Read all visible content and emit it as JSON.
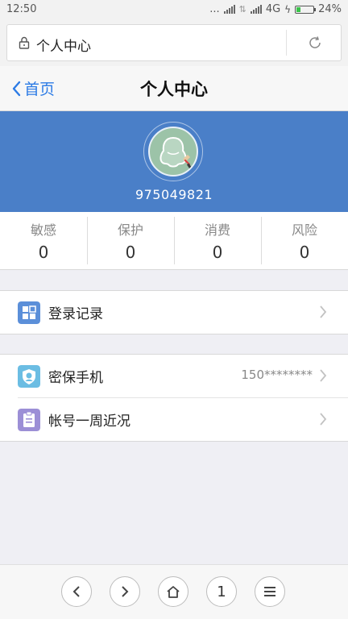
{
  "status_bar": {
    "time": "12:50",
    "dots": "...",
    "network": "4G",
    "battery": "24%",
    "battery_level": 0.24
  },
  "address_bar": {
    "title": "个人中心"
  },
  "nav": {
    "back_label": "首页",
    "title": "个人中心"
  },
  "profile": {
    "user_id": "975049821",
    "banner_color": "#4a7fc8"
  },
  "stats": [
    {
      "label": "敏感",
      "value": "0"
    },
    {
      "label": "保护",
      "value": "0"
    },
    {
      "label": "消费",
      "value": "0"
    },
    {
      "label": "风险",
      "value": "0"
    }
  ],
  "menu": {
    "login_records": {
      "label": "登录记录",
      "icon": "grid-icon",
      "color": "#5b8fd9"
    },
    "security_phone": {
      "label": "密保手机",
      "value": "150********",
      "icon": "shield-icon",
      "color": "#6bbde3"
    },
    "account_week": {
      "label": "帐号一周近况",
      "icon": "clipboard-icon",
      "color": "#9c8fd6"
    }
  },
  "toolbar": {
    "tab_count": "1",
    "items": [
      "back-icon",
      "forward-icon",
      "home-icon",
      "tabs-count",
      "menu-icon"
    ]
  },
  "accent_color": "#2c7be5"
}
